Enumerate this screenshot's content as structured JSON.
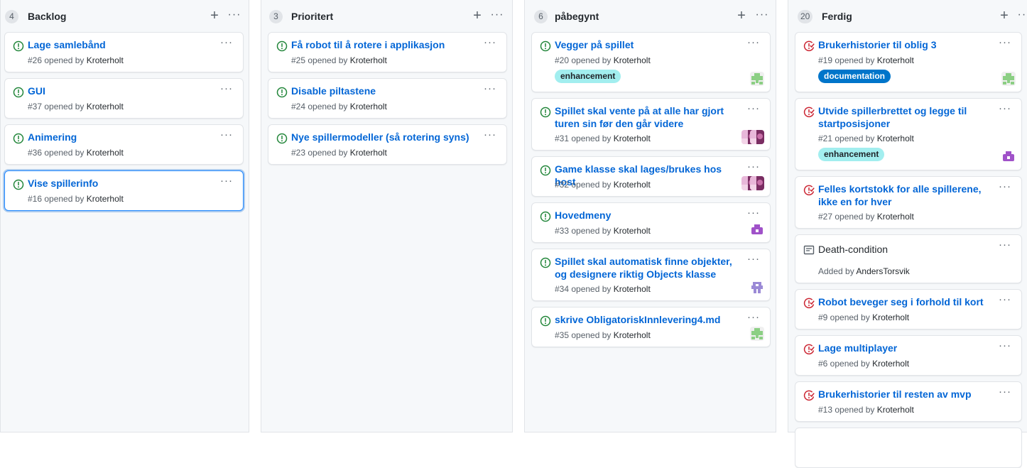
{
  "columns": [
    {
      "title": "Backlog",
      "count": "4",
      "add": "+",
      "menu": "···",
      "cards": [
        {
          "title": "Lage samlebånd",
          "number": "#26 opened by",
          "author": "Kroterholt",
          "menu": "···"
        },
        {
          "title": "GUI",
          "number": "#37 opened by",
          "author": "Kroterholt",
          "menu": "···"
        },
        {
          "title": "Animering",
          "number": "#36 opened by",
          "author": "Kroterholt",
          "menu": "···"
        },
        {
          "title": "Vise spillerinfo",
          "number": "#16 opened by",
          "author": "Kroterholt",
          "menu": "···"
        }
      ]
    },
    {
      "title": "Prioritert",
      "count": "3",
      "add": "+",
      "menu": "···",
      "cards": [
        {
          "title": "Få robot til å rotere i applikasjon",
          "number": "#25 opened by",
          "author": "Kroterholt",
          "menu": "···"
        },
        {
          "title": "Disable piltastene",
          "number": "#24 opened by",
          "author": "Kroterholt",
          "menu": "···"
        },
        {
          "title": "Nye spillermodeller (så rotering syns)",
          "number": "#23 opened by",
          "author": "Kroterholt",
          "menu": "···"
        }
      ]
    },
    {
      "title": "påbegynt",
      "count": "6",
      "add": "+",
      "menu": "···",
      "cards": [
        {
          "title": "Vegger på spillet",
          "number": "#20 opened by",
          "author": "Kroterholt",
          "menu": "···",
          "label": "enhancement"
        },
        {
          "title": "Spillet skal vente på at alle har gjort turen sin før den går videre",
          "number": "#31 opened by",
          "author": "Kroterholt",
          "menu": "···"
        },
        {
          "title": "Game klasse skal lages/brukes hos host",
          "number": "#32 opened by",
          "author": "Kroterholt",
          "menu": "···"
        },
        {
          "title": "Hovedmeny",
          "number": "#33 opened by",
          "author": "Kroterholt",
          "menu": "···"
        },
        {
          "title": "Spillet skal automatisk finne objekter, og designere riktig Objects klasse",
          "number": "#34 opened by",
          "author": "Kroterholt",
          "menu": "···"
        },
        {
          "title": "skrive ObligatoriskInnlevering4.md",
          "number": "#35 opened by",
          "author": "Kroterholt",
          "menu": "···"
        }
      ]
    },
    {
      "title": "Ferdig",
      "count": "20",
      "add": "+",
      "menu": "···",
      "cards": [
        {
          "title": "Brukerhistorier til oblig 3",
          "number": "#19 opened by",
          "author": "Kroterholt",
          "menu": "···",
          "label": "documentation"
        },
        {
          "title": "Utvide spillerbrettet og legge til startposisjoner",
          "number": "#21 opened by",
          "author": "Kroterholt",
          "menu": "···",
          "label": "enhancement"
        },
        {
          "title": "Felles kortstokk for alle spillerene, ikke en for hver",
          "number": "#27 opened by",
          "author": "Kroterholt",
          "menu": "···"
        },
        {
          "title": "Death-condition",
          "number": "Added by",
          "author": "AndersTorsvik",
          "menu": "···"
        },
        {
          "title": "Robot beveger seg i forhold til kort",
          "number": "#9 opened by",
          "author": "Kroterholt",
          "menu": "···"
        },
        {
          "title": "Lage multiplayer",
          "number": "#6 opened by",
          "author": "Kroterholt",
          "menu": "···"
        },
        {
          "title": "Brukerhistorier til resten av mvp",
          "number": "#13 opened by",
          "author": "Kroterholt",
          "menu": "···"
        }
      ]
    }
  ],
  "icons": {
    "open_issue": "issue-opened-icon",
    "closed_issue": "issue-closed-icon",
    "note": "note-icon"
  },
  "colors": {
    "open": "#22863a",
    "closed": "#cb2431",
    "link": "#0366d6",
    "enhancement": "#a2eeef",
    "documentation": "#0075ca"
  }
}
